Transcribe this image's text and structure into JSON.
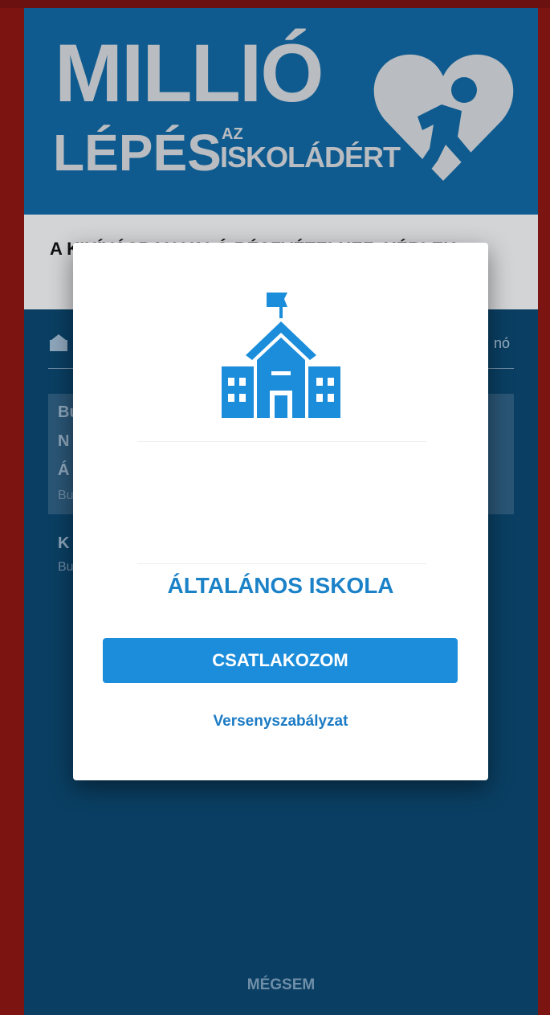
{
  "logo": {
    "word1": "MILLIÓ",
    "word2": "LÉPÉS",
    "az": "AZ",
    "word3": "ISKOLÁDÉRT",
    "icon": "heart-running-person-icon"
  },
  "instruction": {
    "text": "A KIHÍVÁSBAN VALÓ RÉSZVÉTELHEZ, KÉRLEK,"
  },
  "background_list": {
    "header_right": "nó",
    "item1_fragments": [
      "Bu",
      "N",
      "Á",
      "Bu"
    ],
    "item2_fragments": [
      "K",
      "Bu"
    ]
  },
  "modal": {
    "icon": "school-building-icon",
    "school_type": "ÁLTALÁNOS ISKOLA",
    "join_label": "CSATLAKOZOM",
    "rules_link": "Versenyszabályzat"
  },
  "cancel_label": "MÉGSEM",
  "colors": {
    "frame": "#7c1512",
    "app_bg": "#0d4f7c",
    "accent": "#1b8ddb",
    "logo_gray": "#b9bcc0"
  }
}
